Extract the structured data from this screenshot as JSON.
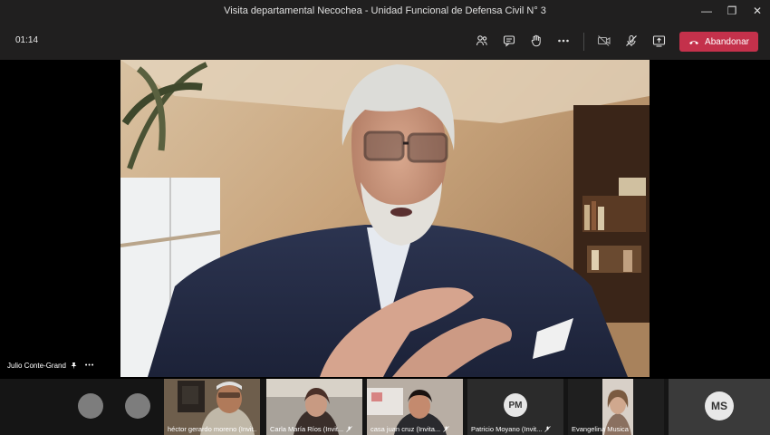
{
  "window": {
    "title": "Visita departamental Necochea - Unidad Funcional de Defensa Civil N° 3",
    "minimize": "—",
    "maximize": "❐",
    "close": "✕"
  },
  "toolbar": {
    "timer": "01:14",
    "icons": [
      "participants-icon",
      "chat-icon",
      "raise-hand-icon",
      "more-options-icon",
      "camera-off-icon",
      "mic-off-icon",
      "share-screen-icon"
    ],
    "leave_label": "Abandonar",
    "leave_color": "#c4314b"
  },
  "stage": {
    "speaker_name": "Julio Conte-Grand",
    "more": "•••"
  },
  "participants": [
    {
      "name": "héctor gerardo moreno (Invit...",
      "type": "video"
    },
    {
      "name": "Carla María Ríos (Invit...",
      "type": "video"
    },
    {
      "name": "casa juan cruz (Invita...",
      "type": "video"
    },
    {
      "name": "Patricio Moyano (Invit...",
      "type": "avatar",
      "initials": "PM"
    },
    {
      "name": "Evangelina Musica",
      "type": "video"
    },
    {
      "name": "",
      "type": "avatar",
      "initials": "MS"
    }
  ]
}
